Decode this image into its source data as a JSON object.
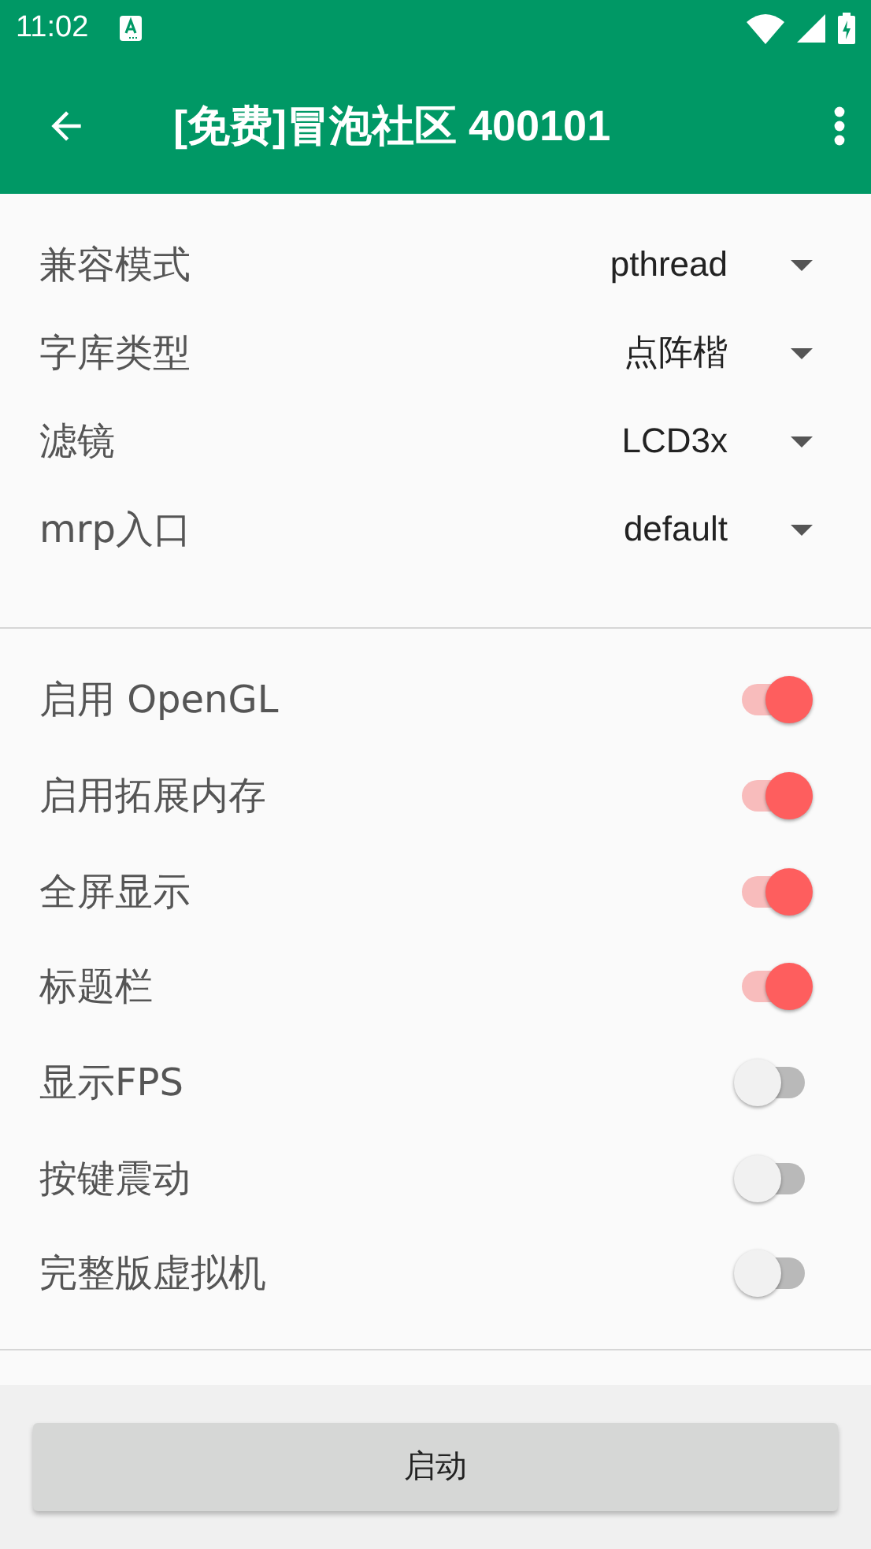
{
  "status_bar": {
    "time": "11:02"
  },
  "app_bar": {
    "title": "[免费]冒泡社区 400101"
  },
  "settings": [
    {
      "label": "兼容模式",
      "value": "pthread"
    },
    {
      "label": "字库类型",
      "value": "点阵楷"
    },
    {
      "label": "滤镜",
      "value": "LCD3x"
    },
    {
      "label": "mrp入口",
      "value": "default"
    }
  ],
  "toggles": [
    {
      "label": "启用 OpenGL",
      "on": true
    },
    {
      "label": "启用拓展内存",
      "on": true
    },
    {
      "label": "全屏显示",
      "on": true
    },
    {
      "label": "标题栏",
      "on": true
    },
    {
      "label": "显示FPS",
      "on": false
    },
    {
      "label": "按键震动",
      "on": false
    },
    {
      "label": "完整版虚拟机",
      "on": false
    }
  ],
  "start_button": "启动"
}
